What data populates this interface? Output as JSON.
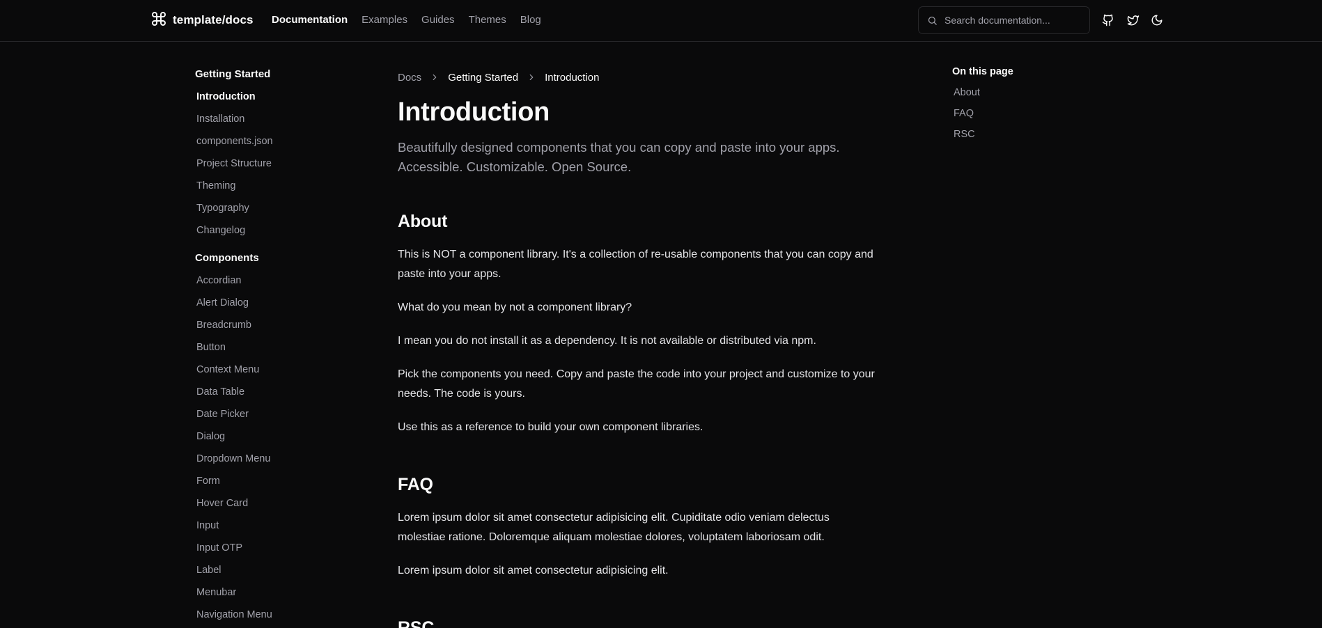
{
  "header": {
    "brand": "template/docs",
    "brand_icon": "command-icon",
    "nav": [
      {
        "label": "Documentation",
        "active": true
      },
      {
        "label": "Examples",
        "active": false
      },
      {
        "label": "Guides",
        "active": false
      },
      {
        "label": "Themes",
        "active": false
      },
      {
        "label": "Blog",
        "active": false
      }
    ],
    "search_placeholder": "Search documentation...",
    "icons": [
      "github-icon",
      "twitter-icon",
      "moon-icon"
    ]
  },
  "sidebar": {
    "groups": [
      {
        "heading": "Getting Started",
        "items": [
          "Introduction",
          "Installation",
          "components.json",
          "Project Structure",
          "Theming",
          "Typography",
          "Changelog"
        ],
        "active_item": "Introduction"
      },
      {
        "heading": "Components",
        "items": [
          "Accordian",
          "Alert Dialog",
          "Breadcrumb",
          "Button",
          "Context Menu",
          "Data Table",
          "Date Picker",
          "Dialog",
          "Dropdown Menu",
          "Form",
          "Hover Card",
          "Input",
          "Input OTP",
          "Label",
          "Menubar",
          "Navigation Menu"
        ]
      }
    ]
  },
  "breadcrumb": [
    "Docs",
    "Getting Started",
    "Introduction"
  ],
  "main": {
    "title": "Introduction",
    "lead": "Beautifully designed components that you can copy and paste into your apps. Accessible. Customizable. Open Source.",
    "about_heading": "About",
    "about_paragraphs": [
      "This is NOT a component library. It's a collection of re-usable components that you can copy and paste into your apps.",
      "What do you mean by not a component library?",
      "I mean you do not install it as a dependency. It is not available or distributed via npm.",
      "Pick the components you need. Copy and paste the code into your project and customize to your needs. The code is yours.",
      "Use this as a reference to build your own component libraries."
    ],
    "faq_heading": "FAQ",
    "faq_paragraphs": [
      "Lorem ipsum dolor sit amet consectetur adipisicing elit. Cupiditate odio veniam delectus molestiae ratione. Doloremque aliquam molestiae dolores, voluptatem laboriosam odit.",
      "Lorem ipsum dolor sit amet consectetur adipisicing elit."
    ],
    "rsc_heading": "RSC"
  },
  "toc": {
    "title": "On this page",
    "items": [
      "About",
      "FAQ",
      "RSC"
    ]
  },
  "colors": {
    "background": "#0a0a0b",
    "foreground": "#fafafa",
    "muted": "#a1a1aa",
    "border": "#27272a"
  }
}
